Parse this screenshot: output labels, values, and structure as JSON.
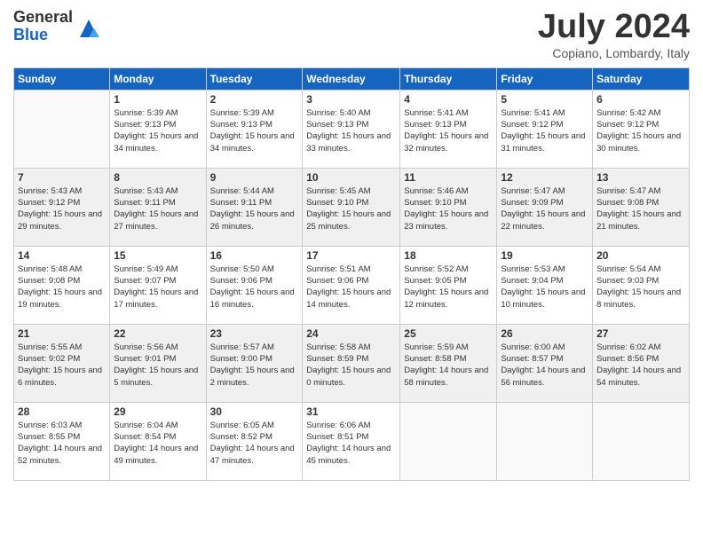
{
  "logo": {
    "general": "General",
    "blue": "Blue"
  },
  "title": "July 2024",
  "location": "Copiano, Lombardy, Italy",
  "headers": [
    "Sunday",
    "Monday",
    "Tuesday",
    "Wednesday",
    "Thursday",
    "Friday",
    "Saturday"
  ],
  "weeks": [
    [
      {
        "num": "",
        "sunrise": "",
        "sunset": "",
        "daylight": ""
      },
      {
        "num": "1",
        "sunrise": "Sunrise: 5:39 AM",
        "sunset": "Sunset: 9:13 PM",
        "daylight": "Daylight: 15 hours and 34 minutes."
      },
      {
        "num": "2",
        "sunrise": "Sunrise: 5:39 AM",
        "sunset": "Sunset: 9:13 PM",
        "daylight": "Daylight: 15 hours and 34 minutes."
      },
      {
        "num": "3",
        "sunrise": "Sunrise: 5:40 AM",
        "sunset": "Sunset: 9:13 PM",
        "daylight": "Daylight: 15 hours and 33 minutes."
      },
      {
        "num": "4",
        "sunrise": "Sunrise: 5:41 AM",
        "sunset": "Sunset: 9:13 PM",
        "daylight": "Daylight: 15 hours and 32 minutes."
      },
      {
        "num": "5",
        "sunrise": "Sunrise: 5:41 AM",
        "sunset": "Sunset: 9:12 PM",
        "daylight": "Daylight: 15 hours and 31 minutes."
      },
      {
        "num": "6",
        "sunrise": "Sunrise: 5:42 AM",
        "sunset": "Sunset: 9:12 PM",
        "daylight": "Daylight: 15 hours and 30 minutes."
      }
    ],
    [
      {
        "num": "7",
        "sunrise": "Sunrise: 5:43 AM",
        "sunset": "Sunset: 9:12 PM",
        "daylight": "Daylight: 15 hours and 29 minutes."
      },
      {
        "num": "8",
        "sunrise": "Sunrise: 5:43 AM",
        "sunset": "Sunset: 9:11 PM",
        "daylight": "Daylight: 15 hours and 27 minutes."
      },
      {
        "num": "9",
        "sunrise": "Sunrise: 5:44 AM",
        "sunset": "Sunset: 9:11 PM",
        "daylight": "Daylight: 15 hours and 26 minutes."
      },
      {
        "num": "10",
        "sunrise": "Sunrise: 5:45 AM",
        "sunset": "Sunset: 9:10 PM",
        "daylight": "Daylight: 15 hours and 25 minutes."
      },
      {
        "num": "11",
        "sunrise": "Sunrise: 5:46 AM",
        "sunset": "Sunset: 9:10 PM",
        "daylight": "Daylight: 15 hours and 23 minutes."
      },
      {
        "num": "12",
        "sunrise": "Sunrise: 5:47 AM",
        "sunset": "Sunset: 9:09 PM",
        "daylight": "Daylight: 15 hours and 22 minutes."
      },
      {
        "num": "13",
        "sunrise": "Sunrise: 5:47 AM",
        "sunset": "Sunset: 9:08 PM",
        "daylight": "Daylight: 15 hours and 21 minutes."
      }
    ],
    [
      {
        "num": "14",
        "sunrise": "Sunrise: 5:48 AM",
        "sunset": "Sunset: 9:08 PM",
        "daylight": "Daylight: 15 hours and 19 minutes."
      },
      {
        "num": "15",
        "sunrise": "Sunrise: 5:49 AM",
        "sunset": "Sunset: 9:07 PM",
        "daylight": "Daylight: 15 hours and 17 minutes."
      },
      {
        "num": "16",
        "sunrise": "Sunrise: 5:50 AM",
        "sunset": "Sunset: 9:06 PM",
        "daylight": "Daylight: 15 hours and 16 minutes."
      },
      {
        "num": "17",
        "sunrise": "Sunrise: 5:51 AM",
        "sunset": "Sunset: 9:06 PM",
        "daylight": "Daylight: 15 hours and 14 minutes."
      },
      {
        "num": "18",
        "sunrise": "Sunrise: 5:52 AM",
        "sunset": "Sunset: 9:05 PM",
        "daylight": "Daylight: 15 hours and 12 minutes."
      },
      {
        "num": "19",
        "sunrise": "Sunrise: 5:53 AM",
        "sunset": "Sunset: 9:04 PM",
        "daylight": "Daylight: 15 hours and 10 minutes."
      },
      {
        "num": "20",
        "sunrise": "Sunrise: 5:54 AM",
        "sunset": "Sunset: 9:03 PM",
        "daylight": "Daylight: 15 hours and 8 minutes."
      }
    ],
    [
      {
        "num": "21",
        "sunrise": "Sunrise: 5:55 AM",
        "sunset": "Sunset: 9:02 PM",
        "daylight": "Daylight: 15 hours and 6 minutes."
      },
      {
        "num": "22",
        "sunrise": "Sunrise: 5:56 AM",
        "sunset": "Sunset: 9:01 PM",
        "daylight": "Daylight: 15 hours and 5 minutes."
      },
      {
        "num": "23",
        "sunrise": "Sunrise: 5:57 AM",
        "sunset": "Sunset: 9:00 PM",
        "daylight": "Daylight: 15 hours and 2 minutes."
      },
      {
        "num": "24",
        "sunrise": "Sunrise: 5:58 AM",
        "sunset": "Sunset: 8:59 PM",
        "daylight": "Daylight: 15 hours and 0 minutes."
      },
      {
        "num": "25",
        "sunrise": "Sunrise: 5:59 AM",
        "sunset": "Sunset: 8:58 PM",
        "daylight": "Daylight: 14 hours and 58 minutes."
      },
      {
        "num": "26",
        "sunrise": "Sunrise: 6:00 AM",
        "sunset": "Sunset: 8:57 PM",
        "daylight": "Daylight: 14 hours and 56 minutes."
      },
      {
        "num": "27",
        "sunrise": "Sunrise: 6:02 AM",
        "sunset": "Sunset: 8:56 PM",
        "daylight": "Daylight: 14 hours and 54 minutes."
      }
    ],
    [
      {
        "num": "28",
        "sunrise": "Sunrise: 6:03 AM",
        "sunset": "Sunset: 8:55 PM",
        "daylight": "Daylight: 14 hours and 52 minutes."
      },
      {
        "num": "29",
        "sunrise": "Sunrise: 6:04 AM",
        "sunset": "Sunset: 8:54 PM",
        "daylight": "Daylight: 14 hours and 49 minutes."
      },
      {
        "num": "30",
        "sunrise": "Sunrise: 6:05 AM",
        "sunset": "Sunset: 8:52 PM",
        "daylight": "Daylight: 14 hours and 47 minutes."
      },
      {
        "num": "31",
        "sunrise": "Sunrise: 6:06 AM",
        "sunset": "Sunset: 8:51 PM",
        "daylight": "Daylight: 14 hours and 45 minutes."
      },
      {
        "num": "",
        "sunrise": "",
        "sunset": "",
        "daylight": ""
      },
      {
        "num": "",
        "sunrise": "",
        "sunset": "",
        "daylight": ""
      },
      {
        "num": "",
        "sunrise": "",
        "sunset": "",
        "daylight": ""
      }
    ]
  ]
}
